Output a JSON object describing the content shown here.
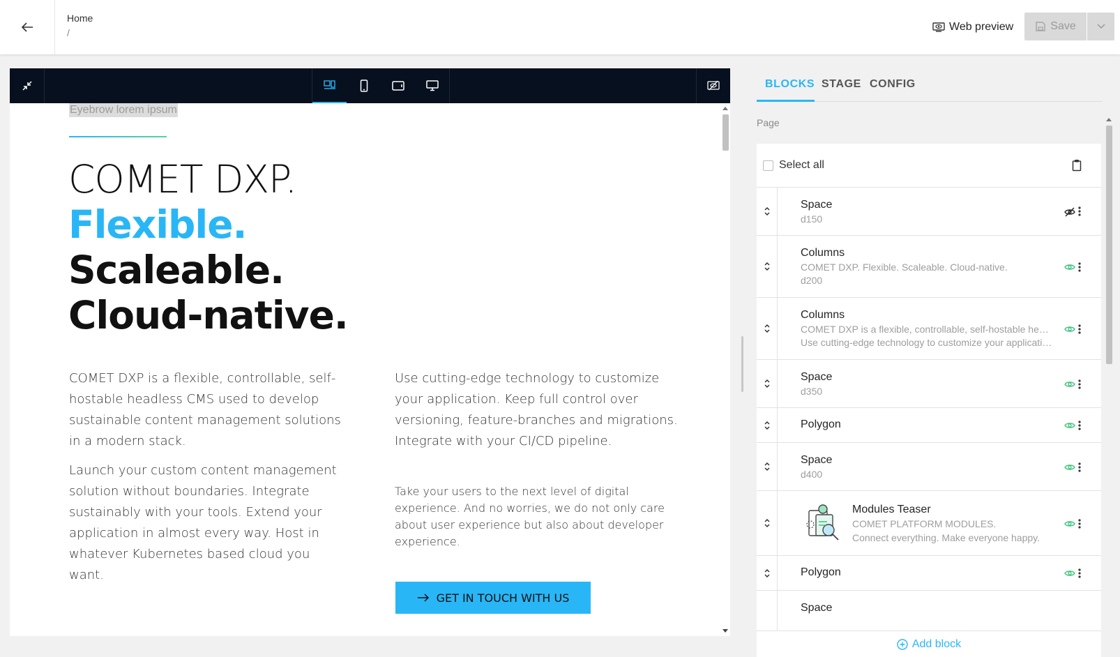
{
  "header": {
    "breadcrumb_home": "Home",
    "breadcrumb_separator": "/",
    "web_preview_label": "Web preview",
    "save_label": "Save"
  },
  "preview_toolbar": {
    "active_device": "responsive",
    "devices": [
      "responsive",
      "mobile",
      "tablet",
      "desktop"
    ]
  },
  "content": {
    "eyebrow": "Eyebrow lorem ipsum",
    "headline": [
      "COMET DXP.",
      "Flexible.",
      "Scaleable.",
      "Cloud-native."
    ],
    "left_paragraphs": [
      "COMET DXP is a flexible, controllable, self-hostable headless CMS used to develop sustainable content management solutions in a modern stack.",
      "Launch your custom content management solution without boundaries. Integrate sustainably with your tools. Extend your application in almost every way. Host in whatever Kubernetes based cloud you want."
    ],
    "right_paragraphs": [
      "Use cutting-edge technology to customize your application. Keep full control over versioning, feature-branches and migrations. Integrate with your CI/CD pipeline.",
      "Take your users to the next level of digital experience. And no worries, we do not only care about user experience but also about developer experience."
    ],
    "cta_label": "GET IN TOUCH WITH US"
  },
  "panel": {
    "tabs": [
      "BLOCKS",
      "STAGE",
      "CONFIG"
    ],
    "active_tab": "BLOCKS",
    "page_label": "Page",
    "select_all_label": "Select all",
    "add_block_label": "Add block",
    "blocks": [
      {
        "title": "Space",
        "lines": [
          "d150"
        ],
        "visible": false
      },
      {
        "title": "Columns",
        "lines": [
          "COMET DXP. Flexible. Scaleable. Cloud-native.",
          "d200"
        ],
        "visible": true
      },
      {
        "title": "Columns",
        "lines": [
          "COMET DXP is a flexible, controllable, self-hostable headless CMS used to develop sustainable content management solutions in a modern stack.",
          "Use cutting-edge technology to customize your application. Keep full control over versioning, feature-branches and migrations."
        ],
        "visible": true
      },
      {
        "title": "Space",
        "lines": [
          "d350"
        ],
        "visible": true
      },
      {
        "title": "Polygon",
        "lines": [],
        "visible": true
      },
      {
        "title": "Space",
        "lines": [
          "d400"
        ],
        "visible": true
      },
      {
        "title": "Modules Teaser",
        "lines": [
          "COMET PLATFORM MODULES.",
          "Connect everything. Make everyone happy."
        ],
        "visible": true,
        "thumbnail": "modules-illustration"
      },
      {
        "title": "Polygon",
        "lines": [],
        "visible": true
      },
      {
        "title": "Space",
        "lines": [],
        "visible": true
      }
    ]
  },
  "colors": {
    "accent": "#29b6f6",
    "visible_eye": "#3ac37a",
    "toolbar_bg": "#06101f"
  }
}
